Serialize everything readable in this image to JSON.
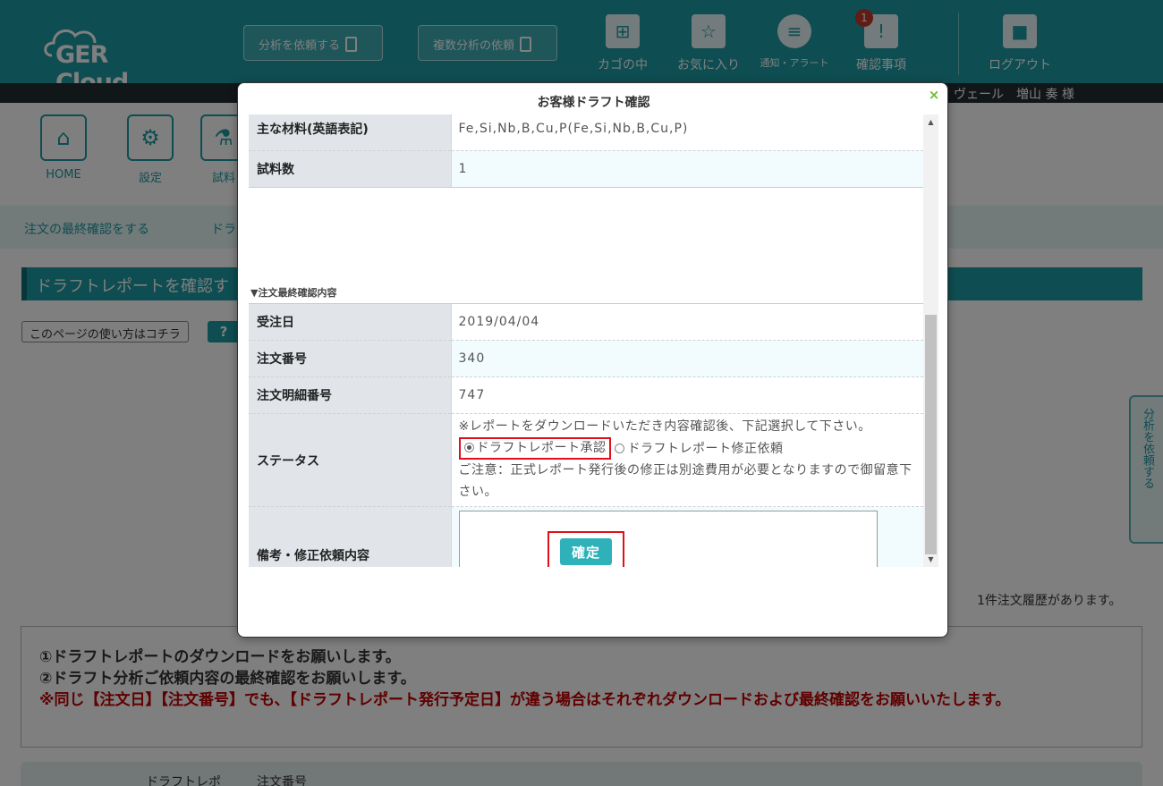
{
  "header": {
    "logo_text": "GER Cloud",
    "request_analysis_btn": "分析を依頼する",
    "request_multi_btn": "複数分析の依頼",
    "nav": [
      {
        "label": "カゴの中",
        "icon": "cart-icon"
      },
      {
        "label": "お気に入り",
        "icon": "favorite-icon"
      },
      {
        "label": "通知・アラート",
        "icon": "chat-bubble-icon"
      },
      {
        "label": "確認事項",
        "icon": "confirm-alert-icon",
        "badge": "1"
      },
      {
        "label": "ログアウト",
        "icon": "lock-icon"
      }
    ],
    "user_text": "ヴェール　増山 奏 様"
  },
  "icon_nav": [
    {
      "label": "HOME",
      "icon": "home-icon"
    },
    {
      "label": "設定",
      "icon": "gear-icon"
    },
    {
      "label": "試料",
      "icon": "flask-icon"
    }
  ],
  "subnav": {
    "item1": "注文の最終確認をする",
    "item2": "ドラ"
  },
  "page_title": "ドラフトレポートを確認す",
  "howto_link": "このページの使い方はコチラ",
  "help_icon_glyph": "?",
  "order_count_text": "1件注文履歴があります。",
  "notice": {
    "line1": "①ドラフトレポートのダウンロードをお願いします。",
    "line2": "②ドラフト分析ご依頼内容の最終確認をお願いします。",
    "line3": "※同じ【注文日】【注文番号】でも、【ドラフトレポート発行予定日】が違う場合はそれぞれダウンロードおよび最終確認をお願いいたします。"
  },
  "table_header": {
    "col1": "ドラフトレポ",
    "col2": "注文番号"
  },
  "side_tab": "分析を依頼する",
  "modal": {
    "title": "お客様ドラフト確認",
    "close_glyph": "×",
    "rows_top": [
      {
        "label": "主な材料(英語表記)",
        "value": "Fe,Si,Nb,B,Cu,P(Fe,Si,Nb,B,Cu,P)"
      },
      {
        "label": "試料数",
        "value": "1"
      }
    ],
    "section_heading": "▼注文最終確認内容",
    "rows_order": [
      {
        "label": "受注日",
        "value": "2019/04/04"
      },
      {
        "label": "注文番号",
        "value": "340"
      },
      {
        "label": "注文明細番号",
        "value": "747"
      }
    ],
    "status": {
      "label": "ステータス",
      "instruction": "※レポートをダウンロードいただき内容確認後、下記選択して下さい。",
      "option_approve": "ドラフトレポート承認",
      "option_revise": "ドラフトレポート修正依頼",
      "selected": "ドラフトレポート承認",
      "caution": "ご注意：正式レポート発行後の修正は別途費用が必要となりますので御留意下さい。"
    },
    "remarks": {
      "label": "備考・修正依頼内容",
      "value": ""
    },
    "confirm_button": "確定"
  },
  "colors": {
    "brand_teal": "#1d9aa3",
    "button_teal": "#2eb1b8",
    "highlight_red": "#e0101a",
    "warning_text": "#c00000"
  }
}
